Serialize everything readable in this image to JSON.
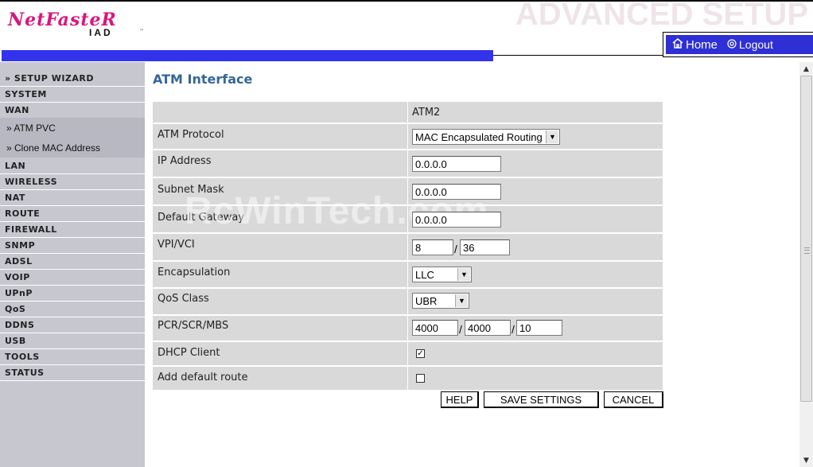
{
  "brand": {
    "logo_main": "NetFasteR",
    "logo_sub": "IAD",
    "logo_tm": "™",
    "page_banner": "ADVANCED SETUP",
    "brand_pink": "#d8177e",
    "nav_blue": "#3333ee"
  },
  "topnav": {
    "home": "Home",
    "logout": "Logout",
    "home_icon": "home-icon",
    "logout_icon": "power-icon"
  },
  "sidebar": {
    "items": [
      {
        "label": "» SETUP WIZARD"
      },
      {
        "label": "SYSTEM"
      },
      {
        "label": "WAN"
      },
      {
        "label": "LAN"
      },
      {
        "label": "WIRELESS"
      },
      {
        "label": "NAT"
      },
      {
        "label": "ROUTE"
      },
      {
        "label": "FIREWALL"
      },
      {
        "label": "SNMP"
      },
      {
        "label": "ADSL"
      },
      {
        "label": "VOIP"
      },
      {
        "label": "UPnP"
      },
      {
        "label": "QoS"
      },
      {
        "label": "DDNS"
      },
      {
        "label": "USB"
      },
      {
        "label": "TOOLS"
      },
      {
        "label": "STATUS"
      }
    ],
    "wan_sub": [
      {
        "label": "» ATM PVC"
      },
      {
        "label": "» Clone MAC Address"
      }
    ]
  },
  "main": {
    "title": "ATM Interface",
    "column_header": "ATM2",
    "fields": {
      "atm_protocol": {
        "label": "ATM Protocol",
        "value": "MAC Encapsulated Routing"
      },
      "ip_address": {
        "label": "IP Address",
        "value": "0.0.0.0"
      },
      "subnet_mask": {
        "label": "Subnet Mask",
        "value": "0.0.0.0"
      },
      "default_gateway": {
        "label": "Default Gateway",
        "value": "0.0.0.0"
      },
      "vpi_vci": {
        "label": "VPI/VCI",
        "vpi": "8",
        "vci": "36",
        "separator": "/"
      },
      "encapsulation": {
        "label": "Encapsulation",
        "value": "LLC"
      },
      "qos_class": {
        "label": "QoS Class",
        "value": "UBR"
      },
      "pcr_scr_mbs": {
        "label": "PCR/SCR/MBS",
        "pcr": "4000",
        "scr": "4000",
        "mbs": "10",
        "separator": "/"
      },
      "dhcp_client": {
        "label": "DHCP Client",
        "checked": true,
        "mark": "✓"
      },
      "add_default_route": {
        "label": "Add default route",
        "checked": false
      }
    },
    "buttons": {
      "help": "HELP",
      "save": "SAVE SETTINGS",
      "cancel": "CANCEL"
    }
  },
  "watermark": "RcWinTech.com"
}
